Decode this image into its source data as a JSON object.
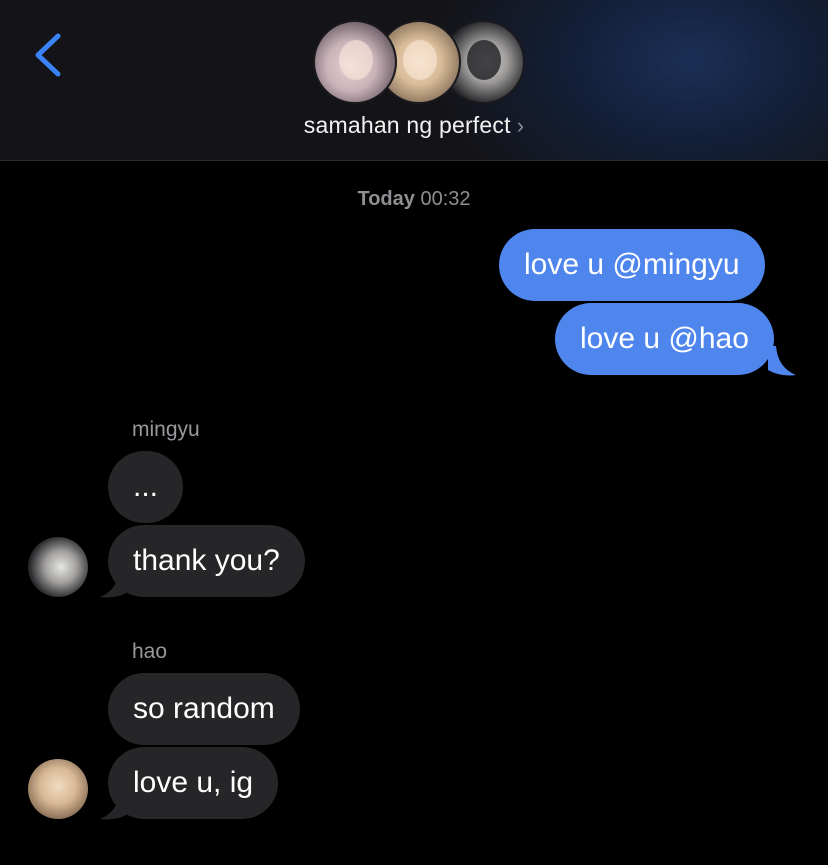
{
  "header": {
    "back_icon": "chevron-left-icon",
    "group_name": "samahan ng perfect",
    "group_chevron": "›",
    "accent_color": "#3a82f6",
    "avatars": [
      "avatar-1",
      "avatar-2",
      "avatar-3"
    ]
  },
  "timestamp": {
    "day": "Today",
    "time": "00:32"
  },
  "messages": [
    {
      "direction": "outgoing",
      "text": "love u @mingyu"
    },
    {
      "direction": "outgoing",
      "text": "love u @hao"
    },
    {
      "direction": "incoming",
      "sender": "mingyu",
      "text": "..."
    },
    {
      "direction": "incoming",
      "text": "thank you?"
    },
    {
      "direction": "incoming",
      "sender": "hao",
      "text": "so random"
    },
    {
      "direction": "incoming",
      "text": "love u, ig"
    }
  ],
  "colors": {
    "outgoing_bubble": "#4f86ee",
    "incoming_bubble": "#262629",
    "background": "#000000"
  }
}
